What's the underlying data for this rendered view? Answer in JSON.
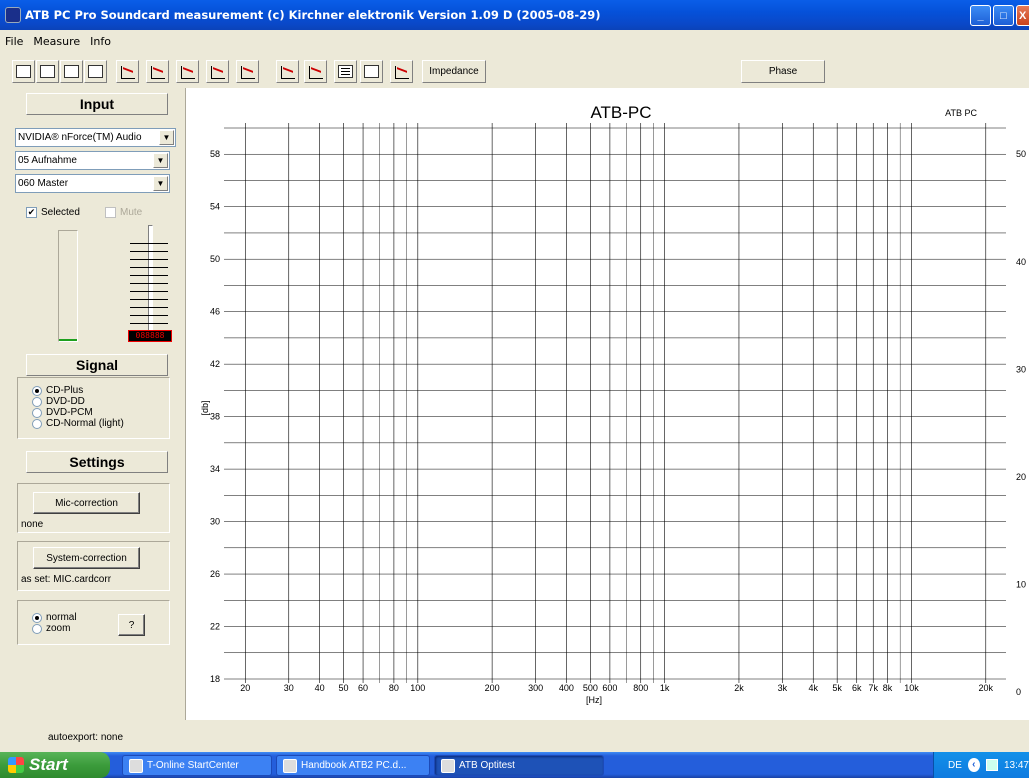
{
  "window": {
    "title": "ATB PC Pro Soundcard measurement (c) Kirchner elektronik    Version 1.09 D (2005-08-29)",
    "buttons": {
      "minimize": "_",
      "maximize": "□",
      "close": "X"
    }
  },
  "menu": [
    "File",
    "Measure",
    "Info"
  ],
  "toolbar": {
    "icons": [
      "new-file-icon",
      "open-file-icon",
      "print-icon",
      "export-icon",
      "measure-m-icon",
      "measure-m-alt-icon",
      "measure-m-plus-icon",
      "measure-m-multi-icon",
      "measure-m2-icon",
      "measure-mt-icon",
      "list-icon",
      "window-icon",
      "curves-icon"
    ],
    "impedance_label": "Impedance",
    "phase_label": "Phase"
  },
  "left": {
    "input_header": "Input",
    "device_select": "NVIDIA® nForce(TM) Audio",
    "source_select": "05 Aufnahme",
    "master_select": "060 Master",
    "selected_label": "Selected",
    "selected_checked": true,
    "mute_label": "Mute",
    "mute_checked": false,
    "slider_readout": "088888",
    "input_level_fraction": 0.02,
    "signal_header": "Signal",
    "signal_options": [
      "CD-Plus",
      "DVD-DD",
      "DVD-PCM",
      "CD-Normal  (light)"
    ],
    "signal_selected": 0,
    "settings_header": "Settings",
    "mic_button": "Mic-correction",
    "mic_value": "none",
    "system_button": "System-correction",
    "system_value": "as set: MIC.cardcorr",
    "view_options": [
      "normal",
      "zoom"
    ],
    "view_selected": 0,
    "help_button": "?"
  },
  "chart_data": {
    "type": "line",
    "title": "ATB-PC",
    "corner_label": "ATB PC",
    "xlabel": "[Hz]",
    "ylabel": "[db]",
    "xscale": "log",
    "xlim": [
      18,
      22000
    ],
    "ylim": [
      18,
      60
    ],
    "x_ticks": [
      "20",
      "30",
      "40",
      "50",
      "60",
      "80",
      "100",
      "200",
      "300",
      "400",
      "500",
      "600",
      "800",
      "1k",
      "2k",
      "3k",
      "4k",
      "5k",
      "6k",
      "7k",
      "8k",
      "10k",
      "20k"
    ],
    "x_tick_values": [
      20,
      30,
      40,
      50,
      60,
      80,
      100,
      200,
      300,
      400,
      500,
      600,
      800,
      1000,
      2000,
      3000,
      4000,
      5000,
      6000,
      7000,
      8000,
      10000,
      20000
    ],
    "y_ticks": [
      58,
      54,
      50,
      46,
      42,
      38,
      34,
      30,
      26,
      22,
      18
    ],
    "y_right_ticks": [
      "50",
      "40",
      "30",
      "20",
      "10",
      "0"
    ],
    "y_right_tick_values": [
      58,
      49.8,
      41.6,
      33.4,
      25.2,
      17
    ],
    "grid": true,
    "series": []
  },
  "status": {
    "autoexport": "autoexport: none"
  },
  "taskbar": {
    "start": "Start",
    "tasks": [
      "T-Online StartCenter",
      "Handbook ATB2 PC.d...",
      "ATB Optitest"
    ],
    "tray_lang": "DE",
    "clock": "13:47"
  }
}
